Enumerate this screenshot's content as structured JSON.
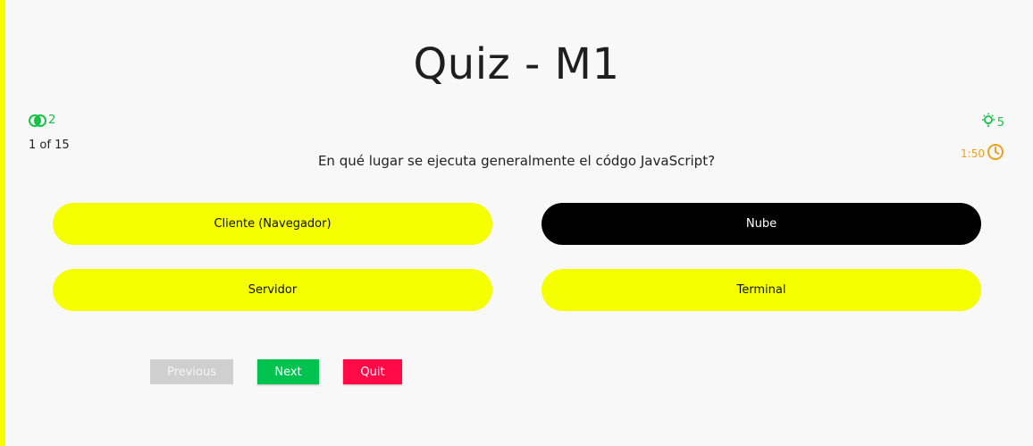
{
  "quiz": {
    "title": "Quiz - M1",
    "lifeline_count": "2",
    "question_counter": "1 of 15",
    "hints_count": "5",
    "timer": "1:50",
    "question": "En qué lugar se ejecuta generalmente el códgo JavaScript?",
    "options": [
      {
        "label": "Cliente (Navegador)"
      },
      {
        "label": "Nube"
      },
      {
        "label": "Servidor"
      },
      {
        "label": "Terminal"
      }
    ],
    "buttons": {
      "previous": "Previous",
      "next": "Next",
      "quit": "Quit"
    }
  },
  "colors": {
    "accent_yellow": "#f5ff00",
    "selected_option": "#000000",
    "next_green": "#00c24e",
    "quit_red": "#ff0a47",
    "disabled_gray": "#cfcfcf",
    "lifeline_green": "#16c24a",
    "timer_orange": "#f0a020"
  },
  "icons": {
    "lifeline": "fifty-fifty-icon",
    "hints": "lightbulb-icon",
    "timer": "clock-icon"
  }
}
